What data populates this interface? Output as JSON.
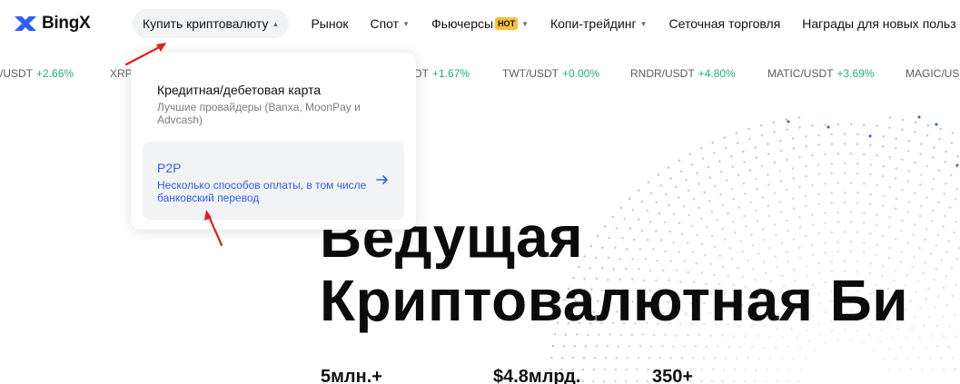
{
  "header": {
    "logo_text": "BingX",
    "nav": [
      {
        "label": "Купить криптовалюту",
        "caret": "▲",
        "active": true
      },
      {
        "label": "Рынок"
      },
      {
        "label": "Спот",
        "caret": "▼"
      },
      {
        "label": "Фьючерсы",
        "badge": "HOT",
        "caret": "▼"
      },
      {
        "label": "Копи-трейдинг",
        "caret": "▼"
      },
      {
        "label": "Сеточная торговля"
      },
      {
        "label": "Награды для новых польз"
      }
    ]
  },
  "ticker": [
    {
      "pair": "/USDT",
      "change": "+2.66%"
    },
    {
      "pair": "XRP",
      "change": ""
    },
    {
      "pair": "DT",
      "change": "+1.67%"
    },
    {
      "pair": "TWT/USDT",
      "change": "+0.00%"
    },
    {
      "pair": "RNDR/USDT",
      "change": "+4.80%"
    },
    {
      "pair": "MATIC/USDT",
      "change": "+3.69%"
    },
    {
      "pair": "MAGIC/USI",
      "change": ""
    }
  ],
  "dropdown": {
    "items": [
      {
        "title": "Кредитная/дебетовая карта",
        "description": "Лучшие провайдеры (Banxa, MoonPay и Advcash)"
      },
      {
        "title": "P2P",
        "description": "Несколько способов оплаты, в том числе банковский перевод"
      }
    ]
  },
  "hero": {
    "line1": "Ведущая",
    "line2": "Криптовалютная Би"
  },
  "stats": [
    "5млн.+",
    "$4.8млрд.",
    "350+"
  ],
  "colors": {
    "accent_blue": "#2d5ef5",
    "positive_green": "#21b07a",
    "hot_badge": "#f5c03c",
    "annotation_red": "#e0201b"
  },
  "icons": {
    "logo": "bingx-x-logo-icon",
    "arrow": "arrow-right-icon"
  }
}
